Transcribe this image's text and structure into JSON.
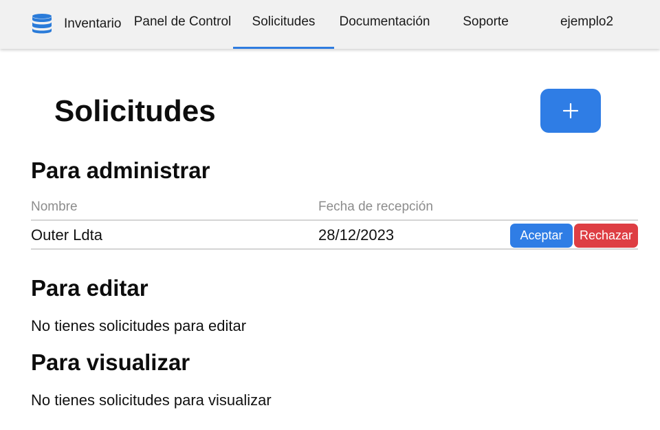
{
  "navbar": {
    "brand_icon": "database-icon",
    "brand_label": "Inventario",
    "links": [
      {
        "label": "Panel de Control",
        "active": false
      },
      {
        "label": "Solicitudes",
        "active": true
      },
      {
        "label": "Documentación",
        "active": false
      },
      {
        "label": "Soporte",
        "active": false
      }
    ],
    "user": "ejemplo2",
    "accent_color": "#2e7be0"
  },
  "page": {
    "title": "Solicitudes",
    "add_button_icon": "plus-icon",
    "add_button_color": "#2f7de5"
  },
  "sections": {
    "administrar": {
      "title": "Para administrar",
      "columns": [
        "Nombre",
        "Fecha de recepción"
      ],
      "rows": [
        {
          "nombre": "Outer Ldta",
          "fecha": "28/12/2023",
          "accept_label": "Aceptar",
          "reject_label": "Rechazar"
        }
      ],
      "accept_color": "#2f7de5",
      "reject_color": "#de3e43"
    },
    "editar": {
      "title": "Para editar",
      "empty_text": "No tienes solicitudes para editar"
    },
    "visualizar": {
      "title": "Para visualizar",
      "empty_text": "No tienes solicitudes para visualizar"
    }
  }
}
